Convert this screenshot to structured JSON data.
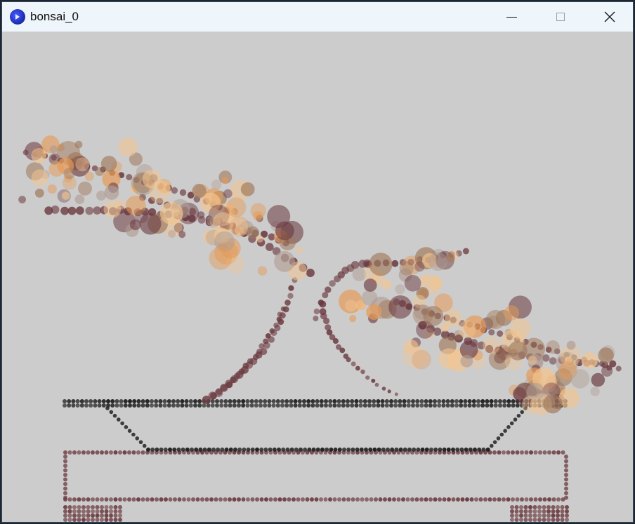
{
  "window": {
    "title": "bonsai_0",
    "icons": {
      "app": "processing-app-icon",
      "minimize": "minimize-icon",
      "maximize": "maximize-icon",
      "close": "close-icon"
    }
  },
  "sketch": {
    "background": "#cccccc",
    "colors": {
      "leaf_peach": "#f3c58f",
      "leaf_orange": "#e69a55",
      "leaf_brown": "#a0785a",
      "leaf_grey": "#b09c92",
      "branch_dot": "#6b3a40",
      "pot_dot": "#222222",
      "base_dot": "#6b3a40"
    }
  }
}
